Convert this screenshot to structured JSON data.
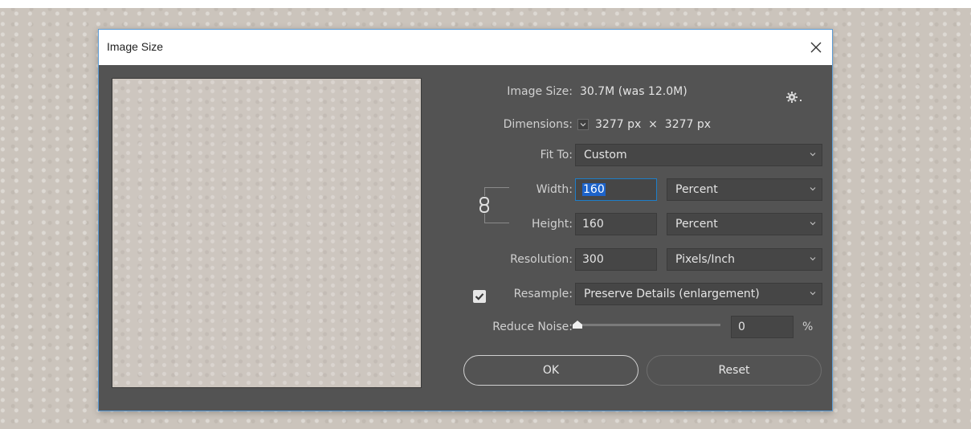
{
  "dialog": {
    "title": "Image Size",
    "image_size_label": "Image Size:",
    "image_size_value": "30.7M (was 12.0M)",
    "dimensions_label": "Dimensions:",
    "dimensions_value": "3277 px  ×  3277 px",
    "fit_to_label": "Fit To:",
    "fit_to_value": "Custom",
    "width_label": "Width:",
    "width_value": "160",
    "width_unit": "Percent",
    "height_label": "Height:",
    "height_value": "160",
    "height_unit": "Percent",
    "resolution_label": "Resolution:",
    "resolution_value": "300",
    "resolution_unit": "Pixels/Inch",
    "resample_label": "Resample:",
    "resample_checked": true,
    "resample_value": "Preserve Details (enlargement)",
    "reduce_noise_label": "Reduce Noise:",
    "reduce_noise_value": "0",
    "reduce_noise_unit": "%",
    "reduce_noise_level": 0,
    "ok_label": "OK",
    "reset_label": "Reset"
  },
  "icons": {
    "close": "close-icon",
    "settings": "gear-icon",
    "constrain": "chain-link-icon",
    "dropdown": "chevron-down-icon",
    "checkbox": "checkmark-icon"
  },
  "colors": {
    "dialog_bg": "#535353",
    "field_bg": "#464646",
    "focus_border": "#1d7ec9",
    "selection": "#1d63c9",
    "window_border": "#5b9bd5"
  }
}
